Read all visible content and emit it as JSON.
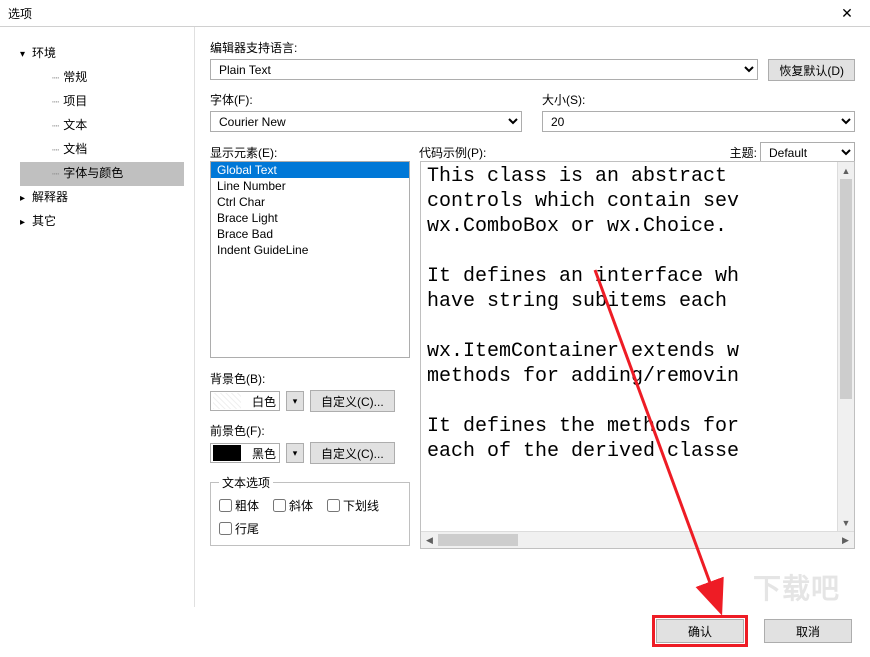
{
  "window": {
    "title": "选项"
  },
  "tree": {
    "env": {
      "label": "环境",
      "children": {
        "general": "常规",
        "project": "项目",
        "text": "文本",
        "doc": "文档",
        "fontcolor": "字体与颜色"
      }
    },
    "interp": "解释器",
    "other": "其它"
  },
  "labels": {
    "editorLang": "编辑器支持语言:",
    "restoreDefault": "恢复默认(D)",
    "font": "字体(F):",
    "size": "大小(S):",
    "elements": "显示元素(E):",
    "sample": "代码示例(P):",
    "theme": "主题:",
    "bg": "背景色(B):",
    "fg": "前景色(F):",
    "custom": "自定义(C)...",
    "textOpts": "文本选项",
    "bold": "粗体",
    "italic": "斜体",
    "underline": "下划线",
    "eol": "行尾",
    "ok": "确认",
    "cancel": "取消"
  },
  "values": {
    "lang": "Plain Text",
    "font": "Courier New",
    "size": "20",
    "theme": "Default",
    "bgName": "白色",
    "fgName": "黑色"
  },
  "elements": [
    "Global Text",
    "Line Number",
    "Ctrl Char",
    "Brace Light",
    "Brace Bad",
    "Indent GuideLine"
  ],
  "elementSel": 0,
  "sampleLines": [
    "This class is an abstract ",
    "controls which contain sev",
    "wx.ComboBox or wx.Choice. ",
    "",
    "It defines an interface wh",
    "have string subitems each ",
    "",
    "wx.ItemContainer extends w",
    "methods for adding/removin",
    "",
    "It defines the methods for",
    "each of the derived classe"
  ],
  "watermark": "下载吧"
}
